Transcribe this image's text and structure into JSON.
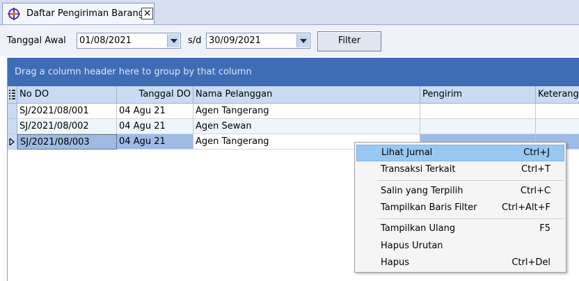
{
  "tab": {
    "title": "Daftar Pengiriman Barang",
    "close": "×",
    "icon": "app-logo-icon"
  },
  "filter": {
    "start_label": "Tanggal Awal",
    "start_value": "01/08/2021",
    "sep_label": "s/d",
    "end_value": "30/09/2021",
    "button": "Filter"
  },
  "grid": {
    "group_hint": "Drag a column header here to group by that column",
    "columns": [
      "No DO",
      "Tanggal DO",
      "Nama Pelanggan",
      "Pengirim",
      "Keterangan"
    ],
    "rows": [
      {
        "no_do": "SJ/2021/08/001",
        "tanggal": "04 Agu 21",
        "pelanggan": "Agen Tangerang"
      },
      {
        "no_do": "SJ/2021/08/002",
        "tanggal": "04 Agu 21",
        "pelanggan": "Agen Sewan"
      },
      {
        "no_do": "SJ/2021/08/003",
        "tanggal": "04 Agu 21",
        "pelanggan": "Agen Tangerang"
      }
    ]
  },
  "context_menu": {
    "items": [
      {
        "label": "Lihat Jurnal",
        "shortcut": "Ctrl+J"
      },
      {
        "label": "Transaksi Terkait",
        "shortcut": "Ctrl+T"
      },
      {
        "label": "Salin yang Terpilih",
        "shortcut": "Ctrl+C"
      },
      {
        "label": "Tampilkan Baris Filter",
        "shortcut": "Ctrl+Alt+F"
      },
      {
        "label": "Tampilkan Ulang",
        "shortcut": "F5"
      },
      {
        "label": "Hapus Urutan",
        "shortcut": ""
      },
      {
        "label": "Hapus",
        "shortcut": "Ctrl+Del"
      }
    ]
  },
  "colors": {
    "group_bar": "#3f6db5",
    "header": "#c9daf2",
    "selected_row": "#9dbbe3",
    "menu_highlight": "#99c8f2"
  }
}
